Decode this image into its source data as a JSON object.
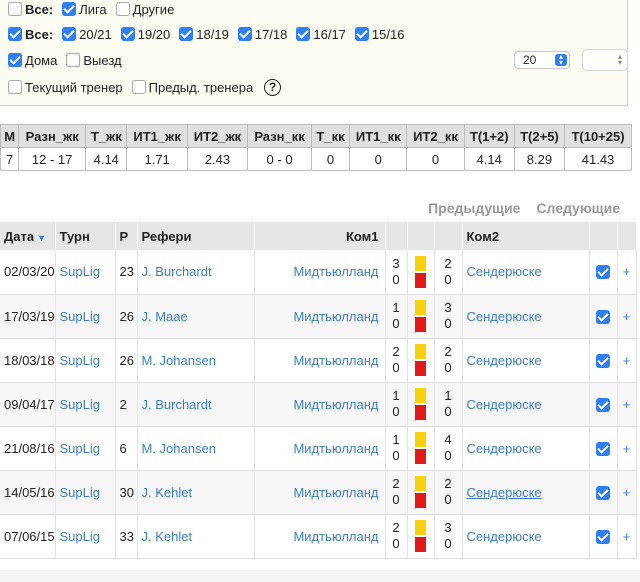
{
  "filters": {
    "row1": [
      {
        "label": "Все:",
        "checked": false,
        "bold": true
      },
      {
        "label": "Лига",
        "checked": true
      },
      {
        "label": "Другие",
        "checked": false
      }
    ],
    "row2": [
      {
        "label": "Все:",
        "checked": true,
        "bold": true
      },
      {
        "label": "20/21",
        "checked": true
      },
      {
        "label": "19/20",
        "checked": true
      },
      {
        "label": "18/19",
        "checked": true
      },
      {
        "label": "17/18",
        "checked": true
      },
      {
        "label": "16/17",
        "checked": true
      },
      {
        "label": "15/16",
        "checked": true
      }
    ],
    "row3": [
      {
        "label": "Дома",
        "checked": true
      },
      {
        "label": "Выезд",
        "checked": false
      }
    ],
    "row4": [
      {
        "label": "Текущий тренер",
        "checked": false
      },
      {
        "label": "Предыд. тренера",
        "checked": false
      }
    ],
    "count_select": "20",
    "help_label": "?"
  },
  "stats": {
    "headers": [
      "М",
      "Разн_жк",
      "Т_жк",
      "ИТ1_жк",
      "ИТ2_жк",
      "Разн_кк",
      "Т_кк",
      "ИТ1_кк",
      "ИТ2_кк",
      "Т(1+2)",
      "Т(2+5)",
      "Т(10+25)"
    ],
    "values": [
      "7",
      "12 - 17",
      "4.14",
      "1.71",
      "2.43",
      "0 - 0",
      "0",
      "0",
      "0",
      "4.14",
      "8.29",
      "41.43"
    ]
  },
  "pager": {
    "prev": "Предыдущие",
    "next": "Следующие"
  },
  "matches": {
    "headers": {
      "date": "Дата",
      "tourn": "Турн",
      "round": "Р",
      "ref": "Рефери",
      "team1": "Ком1",
      "team2": "Ком2"
    },
    "rows": [
      {
        "date": "02/03/20",
        "tourn": "SupLig",
        "round": "23",
        "ref": "J. Burchardt",
        "team1": "Мидтьюлланд",
        "y1": "3",
        "r1": "0",
        "y2": "2",
        "r2": "0",
        "team2": "Сендерюске",
        "checked": true,
        "underline": false
      },
      {
        "date": "17/03/19",
        "tourn": "SupLig",
        "round": "26",
        "ref": "J. Maae",
        "team1": "Мидтьюлланд",
        "y1": "1",
        "r1": "0",
        "y2": "3",
        "r2": "0",
        "team2": "Сендерюске",
        "checked": true,
        "underline": false
      },
      {
        "date": "18/03/18",
        "tourn": "SupLig",
        "round": "26",
        "ref": "M. Johansen",
        "team1": "Мидтьюлланд",
        "y1": "2",
        "r1": "0",
        "y2": "2",
        "r2": "0",
        "team2": "Сендерюске",
        "checked": true,
        "underline": false
      },
      {
        "date": "09/04/17",
        "tourn": "SupLig",
        "round": "2",
        "ref": "J. Burchardt",
        "team1": "Мидтьюлланд",
        "y1": "1",
        "r1": "0",
        "y2": "1",
        "r2": "0",
        "team2": "Сендерюске",
        "checked": true,
        "underline": false
      },
      {
        "date": "21/08/16",
        "tourn": "SupLig",
        "round": "6",
        "ref": "M. Johansen",
        "team1": "Мидтьюлланд",
        "y1": "1",
        "r1": "0",
        "y2": "4",
        "r2": "0",
        "team2": "Сендерюске",
        "checked": true,
        "underline": false
      },
      {
        "date": "14/05/16",
        "tourn": "SupLig",
        "round": "30",
        "ref": "J. Kehlet",
        "team1": "Мидтьюлланд",
        "y1": "2",
        "r1": "0",
        "y2": "2",
        "r2": "0",
        "team2": "Сендерюске",
        "checked": true,
        "underline": true
      },
      {
        "date": "07/06/15",
        "tourn": "SupLig",
        "round": "33",
        "ref": "J. Kehlet",
        "team1": "Мидтьюлланд",
        "y1": "2",
        "r1": "0",
        "y2": "3",
        "r2": "0",
        "team2": "Сендерюске",
        "checked": true,
        "underline": false
      }
    ],
    "plus_label": "+"
  },
  "colors": {
    "accent": "#2d7ff2",
    "link": "#3d7cc9",
    "yellow_card": "#f6d20a",
    "red_card": "#e01a1a"
  }
}
